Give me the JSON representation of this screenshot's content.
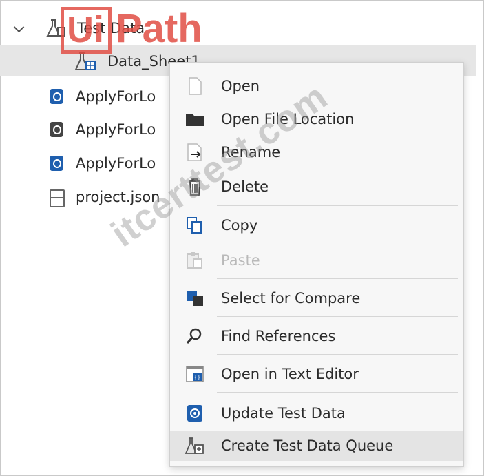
{
  "tree": {
    "root": {
      "label": "Test Data",
      "icon": "flask-icon"
    },
    "items": [
      {
        "label": "Data_Sheet1",
        "icon": "flask-table-icon",
        "selected": true
      },
      {
        "label": "ApplyForLo",
        "icon": "workflow-icon"
      },
      {
        "label": "ApplyForLo",
        "icon": "workflow-icon"
      },
      {
        "label": "ApplyForLo",
        "icon": "workflow-icon"
      },
      {
        "label": "project.json",
        "icon": "json-file-icon"
      }
    ]
  },
  "menu": {
    "items": [
      {
        "label": "Open",
        "icon": "file-icon"
      },
      {
        "label": "Open File Location",
        "icon": "folder-icon"
      },
      {
        "label": "Rename",
        "icon": "rename-icon"
      },
      {
        "label": "Delete",
        "icon": "trash-icon"
      },
      {
        "label": "Copy",
        "icon": "copy-icon"
      },
      {
        "label": "Paste",
        "icon": "paste-icon",
        "disabled": true
      },
      {
        "label": "Select for Compare",
        "icon": "compare-icon"
      },
      {
        "label": "Find References",
        "icon": "search-icon"
      },
      {
        "label": "Open in Text Editor",
        "icon": "text-editor-icon"
      },
      {
        "label": "Update Test Data",
        "icon": "update-test-data-icon"
      },
      {
        "label": "Create Test Data Queue",
        "icon": "test-data-queue-icon",
        "hovered": true
      }
    ]
  },
  "watermark": {
    "logo_ui": "Ui",
    "logo_path": "Path",
    "site": "itcerttest.com"
  },
  "colors": {
    "accent_blue": "#1f5fae",
    "watermark_red": "#e04e44",
    "menu_bg": "#f7f7f7",
    "hover": "#e4e4e4"
  }
}
